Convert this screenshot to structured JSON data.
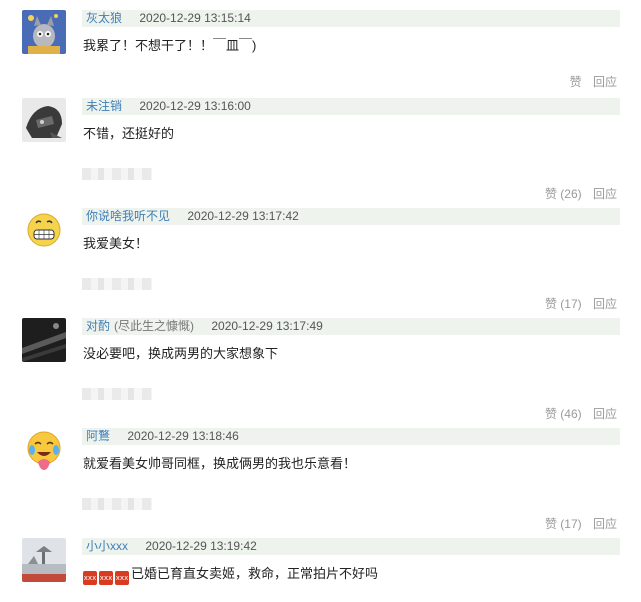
{
  "actions": {
    "like_label": "赞",
    "reply_label": "回应"
  },
  "comments": [
    {
      "username": "灰太狼",
      "time": "2020-12-29 13:15:14",
      "body": "我累了！不想干了！！￣皿￣)",
      "like_count": "",
      "avatar_icon": "wolf-cartoon-avatar"
    },
    {
      "username": "未注销",
      "time": "2020-12-29 13:16:00",
      "body": "不错，还挺好的",
      "like_count": "(26)",
      "avatar_icon": "mech-suit-avatar"
    },
    {
      "username": "你说啥我听不见",
      "time": "2020-12-29 13:17:42",
      "body": "我爱美女！",
      "like_count": "(17)",
      "avatar_icon": "grinning-emoji-avatar"
    },
    {
      "username": "对酌",
      "note": "(尽此生之慷慨)",
      "time": "2020-12-29 13:17:49",
      "body": "没必要吧，换成两男的大家想象下",
      "like_count": "(46)",
      "avatar_icon": "dark-photo-avatar"
    },
    {
      "username": "阿鶩",
      "time": "2020-12-29 13:18:46",
      "body": "就爱看美女帅哥同框，换成俩男的我也乐意看！",
      "like_count": "(17)",
      "avatar_icon": "crying-laughing-emoji-avatar"
    },
    {
      "username": "小小xxx",
      "time": "2020-12-29 13:19:42",
      "body": "已婚已育直女卖姬，救命，正常拍片不好吗",
      "emoji_icons": [
        "xxx",
        "xxx",
        "xxx"
      ],
      "like_count": "",
      "avatar_icon": "landscape-photo-avatar"
    }
  ]
}
